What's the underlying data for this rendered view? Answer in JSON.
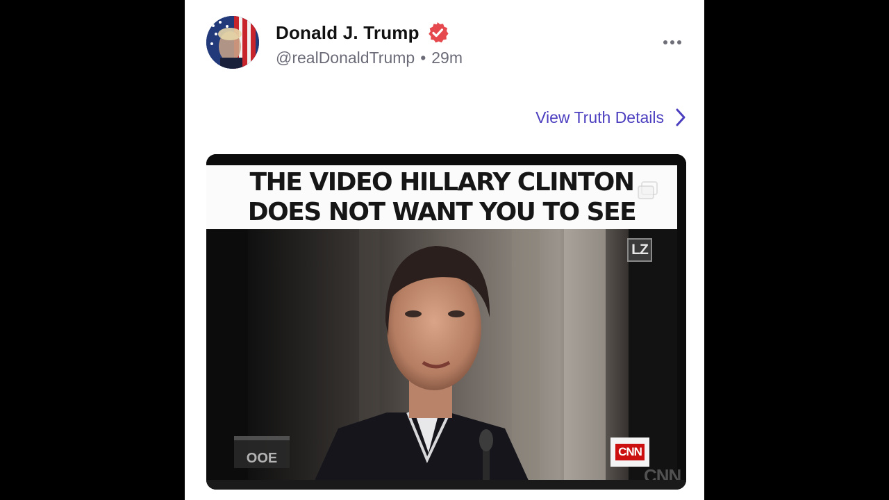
{
  "post": {
    "author": {
      "display_name": "Donald J. Trump",
      "handle": "@realDonaldTrump",
      "verified": true,
      "avatar_icon": "flag-portrait-avatar"
    },
    "separator": "•",
    "time_ago": "29m",
    "menu_icon": "more-horizontal-icon",
    "details_link": {
      "label": "View Truth Details",
      "icon": "chevron-right-icon"
    },
    "media": {
      "banner_lines": [
        "THE VIDEO HILLARY CLINTON",
        "DOES NOT WANT YOU TO SEE"
      ],
      "watermark": "LZ",
      "live_bug": "OOE",
      "network_logo": "CNN",
      "network_logo_ghost": "CNN"
    }
  },
  "colors": {
    "link": "#4b3fbf",
    "verified_badge": "#e5484d",
    "secondary_text": "#6b6b78",
    "page_background": "#000000",
    "card_background": "#ffffff"
  }
}
